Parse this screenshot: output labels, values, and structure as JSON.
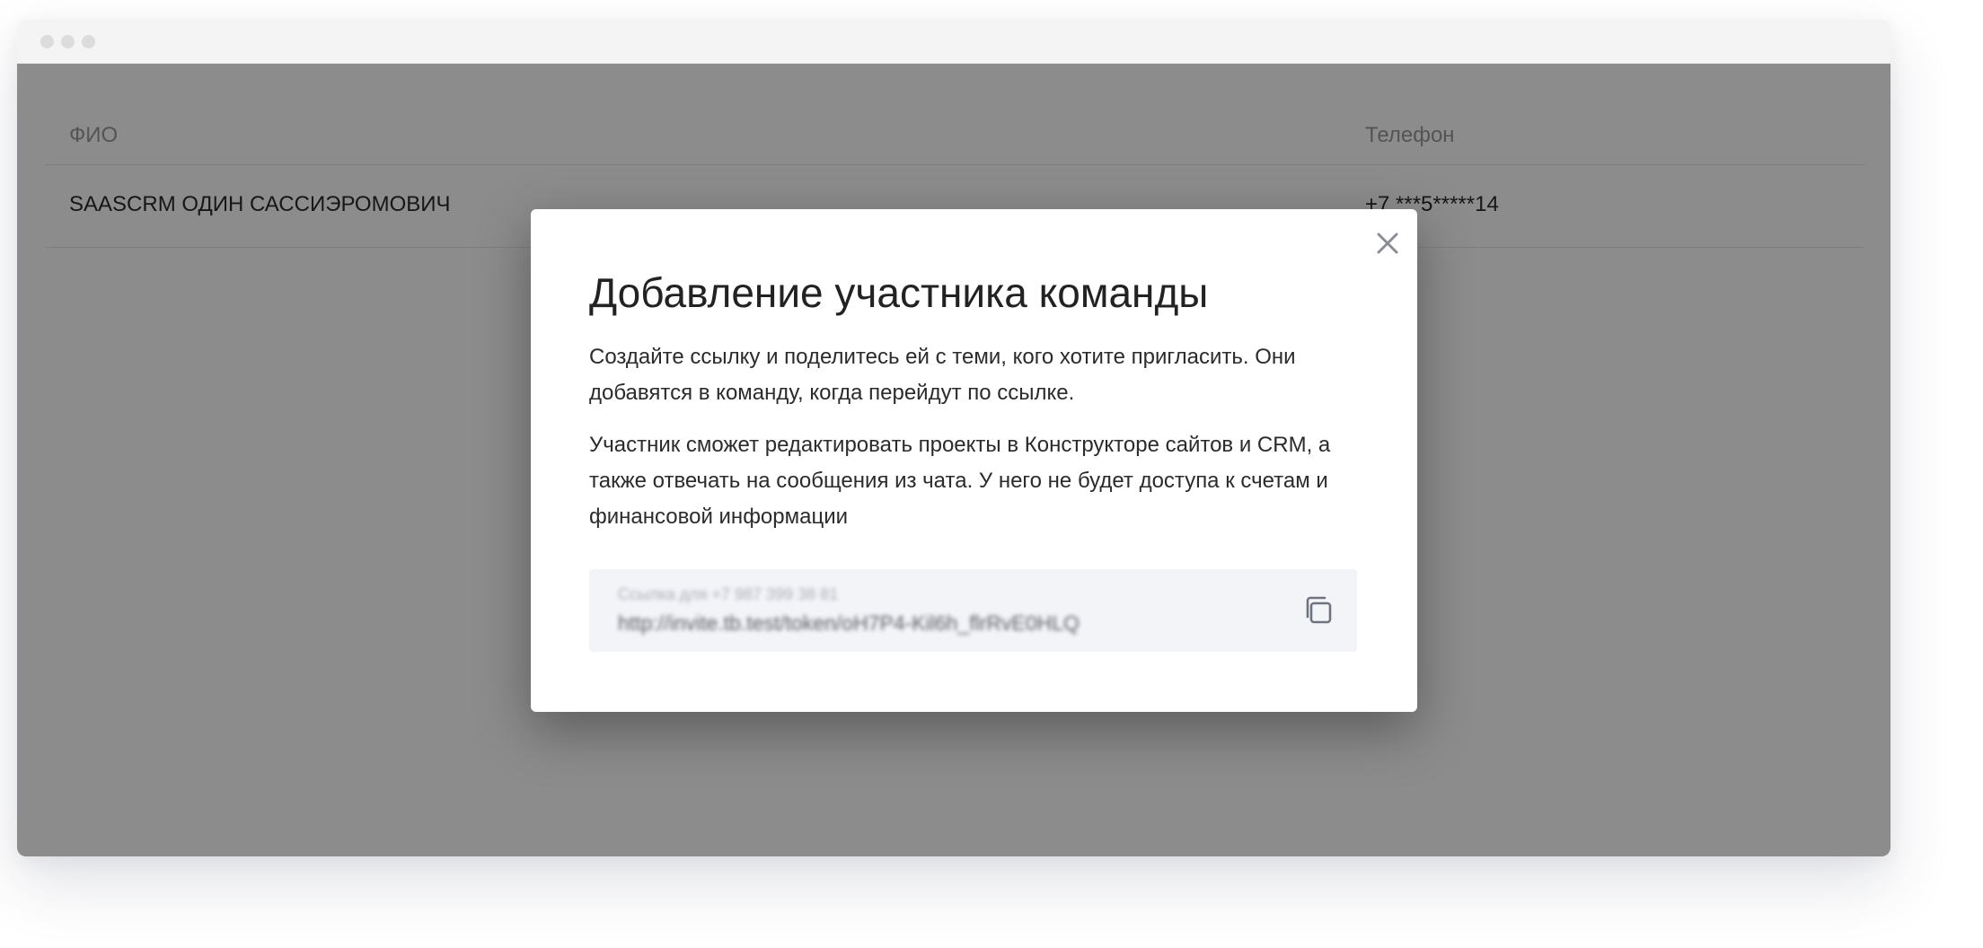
{
  "table": {
    "headers": {
      "name": "ФИО",
      "phone": "Телефон"
    },
    "rows": [
      {
        "name": "SAASCRM ОДИН САССИЭРОМОВИЧ",
        "phone": "+7 ***5*****14"
      }
    ]
  },
  "modal": {
    "title": "Добавление участника команды",
    "paragraph1": "Создайте ссылку и поделитесь ей с теми, кого хотите пригласить. Они добавятся в команду, когда перейдут по ссылке.",
    "paragraph2": "Участник сможет редактировать проекты в Конструкторе сайтов и CRM, а также отвечать на сообщения из чата. У него не будет доступа к счетам и финансовой информации",
    "link": {
      "label": "Ссылка для +7 987 399 38 81",
      "url": "http://invite.tb.test/token/oH7P4-Kil6h_flrRvE0HLQ"
    },
    "icons": {
      "close": "close-icon",
      "copy": "copy-icon"
    }
  },
  "colors": {
    "overlay": "#000000",
    "modal_bg": "#ffffff",
    "link_box_bg": "#f3f4f8"
  }
}
